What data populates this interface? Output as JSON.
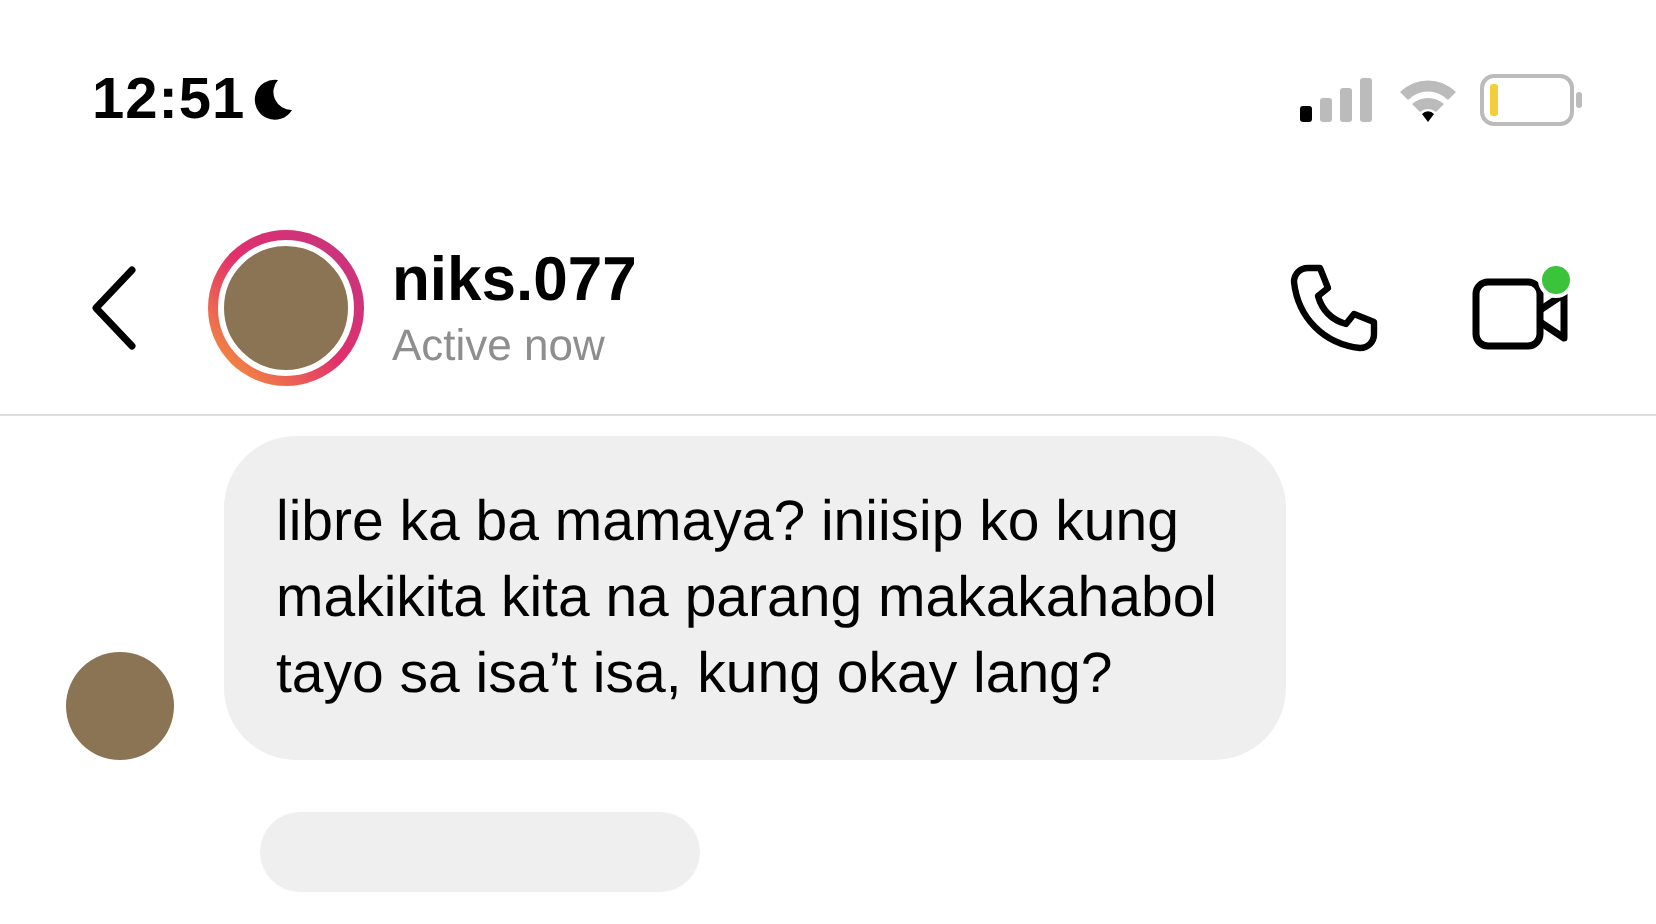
{
  "status_bar": {
    "time": "12:51"
  },
  "header": {
    "username": "niks.077",
    "status": "Active now"
  },
  "messages": [
    {
      "text": "libre ka ba mamaya? iniisip ko kung makikita kita na parang makakahabol tayo sa isa’t isa, kung okay lang?"
    }
  ]
}
